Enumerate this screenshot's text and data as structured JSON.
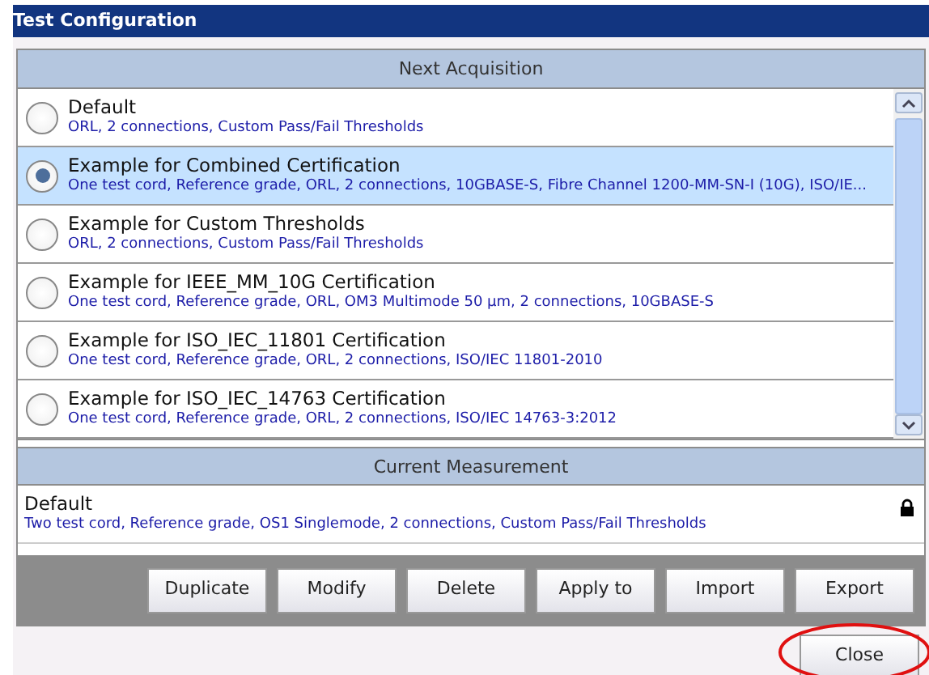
{
  "window": {
    "title": "Test Configuration"
  },
  "next_acquisition": {
    "header": "Next Acquisition",
    "items": [
      {
        "name": "Default",
        "details": "ORL, 2 connections, Custom Pass/Fail Thresholds",
        "selected": false
      },
      {
        "name": "Example for Combined Certification",
        "details": "One test cord, Reference grade, ORL, 2 connections, 10GBASE-S, Fibre Channel 1200-MM-SN-I (10G), ISO/IE...",
        "selected": true
      },
      {
        "name": "Example for Custom Thresholds",
        "details": "ORL, 2 connections, Custom Pass/Fail Thresholds",
        "selected": false
      },
      {
        "name": "Example for IEEE_MM_10G Certification",
        "details": "One test cord, Reference grade, ORL, OM3 Multimode 50 µm, 2 connections, 10GBASE-S",
        "selected": false
      },
      {
        "name": "Example for ISO_IEC_11801 Certification",
        "details": "One test cord, Reference grade, ORL, 2 connections, ISO/IEC 11801-2010",
        "selected": false
      },
      {
        "name": "Example for ISO_IEC_14763 Certification",
        "details": "One test cord, Reference grade, ORL, 2 connections, ISO/IEC 14763-3:2012",
        "selected": false
      }
    ]
  },
  "current_measurement": {
    "header": "Current Measurement",
    "name": "Default",
    "details": "Two test cord, Reference grade, OS1 Singlemode, 2 connections, Custom Pass/Fail Thresholds",
    "locked": true
  },
  "buttons": [
    "Duplicate",
    "Modify",
    "Delete",
    "Apply to",
    "Import",
    "Export"
  ],
  "close_button": "Close"
}
